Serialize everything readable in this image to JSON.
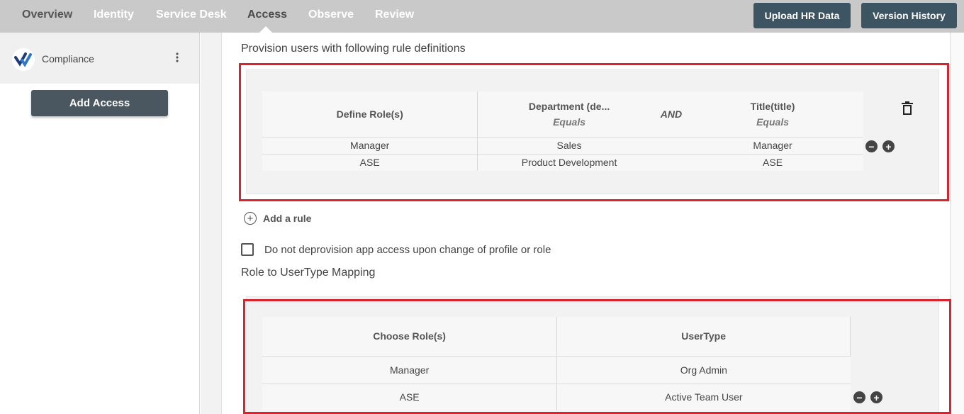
{
  "nav": {
    "tabs": [
      {
        "label": "Overview"
      },
      {
        "label": "Identity"
      },
      {
        "label": "Service Desk"
      },
      {
        "label": "Access"
      },
      {
        "label": "Observe"
      },
      {
        "label": "Review"
      }
    ],
    "active_tab": "Access",
    "upload_label": "Upload HR Data",
    "version_label": "Version History"
  },
  "sidebar": {
    "app_name": "Compliance",
    "add_access_label": "Add Access"
  },
  "provision": {
    "heading": "Provision users with following rule definitions",
    "columns": {
      "role": "Define Role(s)",
      "dept": "Department (de...",
      "dept_op": "Equals",
      "connector": "AND",
      "title": "Title(title)",
      "title_op": "Equals"
    },
    "rows": [
      {
        "role": "Manager",
        "dept": "Sales",
        "title": "Manager"
      },
      {
        "role": "ASE",
        "dept": "Product Development",
        "title": "ASE"
      }
    ],
    "add_rule_label": "Add a rule"
  },
  "deprovision_checkbox": {
    "label": "Do not deprovision app access upon change of profile or role",
    "checked": false
  },
  "mapping": {
    "heading": "Role to UserType Mapping",
    "columns": {
      "role": "Choose Role(s)",
      "usertype": "UserType"
    },
    "rows": [
      {
        "role": "Manager",
        "usertype": "Org Admin"
      },
      {
        "role": "ASE",
        "usertype": "Active Team User"
      }
    ]
  },
  "icons": {
    "delete": "trash-icon",
    "remove": "minus-circle-icon",
    "add": "plus-circle-icon",
    "more": "kebab-menu-icon"
  },
  "colors": {
    "topbar": "#c9c9c9",
    "button": "#3d5462",
    "highlight": "#d9232d"
  }
}
